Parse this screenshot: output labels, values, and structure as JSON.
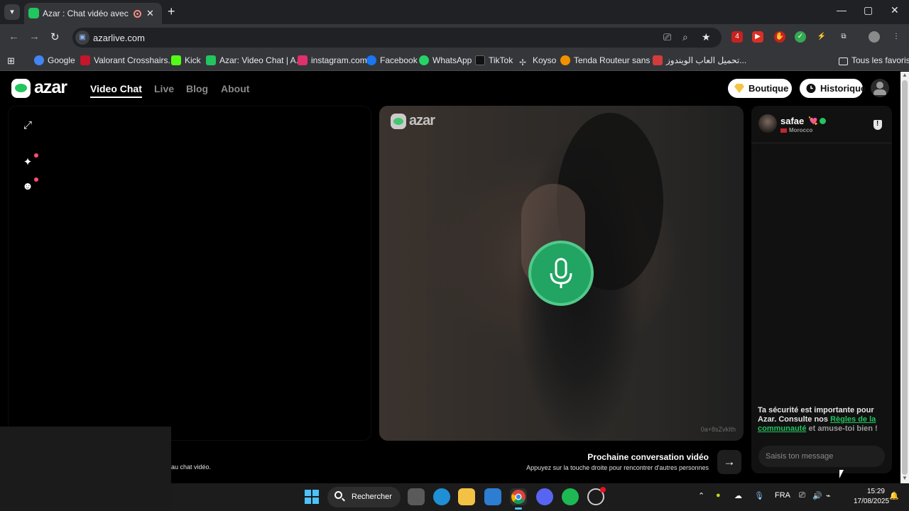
{
  "browser": {
    "tab_title": "Azar : Chat vidéo avec de n",
    "url": "azarlive.com",
    "bookmarks": [
      {
        "label": "Google",
        "color": "#4285f4"
      },
      {
        "label": "Valorant Crosshairs...",
        "color": "#c5162b"
      },
      {
        "label": "Kick",
        "color": "#53fc18"
      },
      {
        "label": "Azar: Video Chat | A...",
        "color": "#22c55e"
      },
      {
        "label": "instagram.com",
        "color": "#e1306c"
      },
      {
        "label": "Facebook",
        "color": "#1877f2"
      },
      {
        "label": "WhatsApp",
        "color": "#25d366"
      },
      {
        "label": "TikTok",
        "color": "#111111"
      },
      {
        "label": "Koyso",
        "color": "#888888"
      },
      {
        "label": "Tenda Routeur sans fil",
        "color": "#f29100"
      },
      {
        "label": "تحميل العاب الويندوز...",
        "color": "#d33c3c"
      }
    ],
    "all_bookmarks": "Tous les favoris",
    "extension_badge": "4"
  },
  "site": {
    "logo": "azar",
    "nav": [
      "Video Chat",
      "Live",
      "Blog",
      "About"
    ],
    "shop_label": "Boutique",
    "history_label": "Historique",
    "accent": "#22c55e"
  },
  "remote": {
    "logo": "azar",
    "id": "0a+8sZvkIth"
  },
  "chat": {
    "partner_name": "safae",
    "partner_emoji": "💘",
    "partner_country": "Morocco",
    "safety_prefix": "Ta sécurité est importante pour Azar. Consulte nos ",
    "safety_link": "Règles de la communauté",
    "safety_suffix": " et amuse-toi bien !",
    "input_placeholder": "Saisis ton message"
  },
  "next": {
    "title": "Prochaine conversation vidéo",
    "hint": "Appuyez sur la touche droite pour rencontrer d'autres personnes"
  },
  "left_caption": "au chat vidéo.",
  "taskbar": {
    "search_label": "Rechercher",
    "language": "FRA",
    "time": "15:29",
    "date": "17/08/2025"
  }
}
